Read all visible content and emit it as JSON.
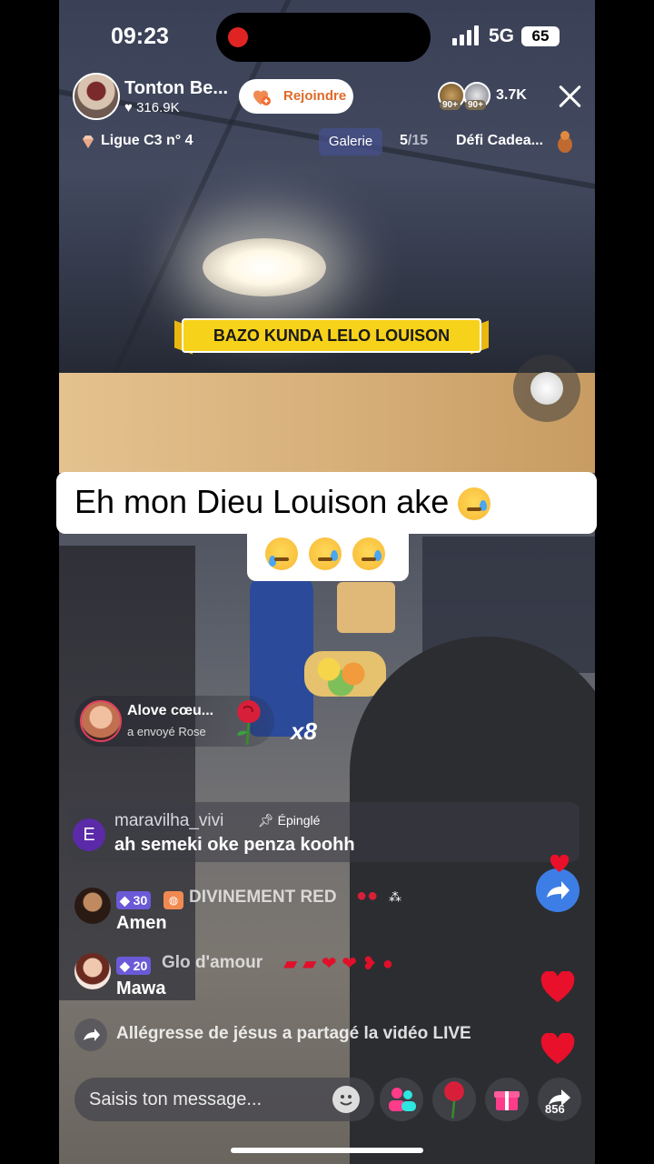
{
  "status_bar": {
    "time": "09:23",
    "network": "5G",
    "battery": "65"
  },
  "host": {
    "name": "Tonton Be...",
    "likes": "316.9K"
  },
  "join_button": {
    "label": "Rejoindre"
  },
  "viewers": {
    "badge_1": "90+",
    "badge_2": "90+",
    "count": "3.7K"
  },
  "league": {
    "label": "Ligue C3 n° 4"
  },
  "gallery": {
    "label": "Galerie",
    "current": "5",
    "total": "/15"
  },
  "challenge": {
    "label": "Défi Cadea..."
  },
  "banner": {
    "text": "BAZO KUNDA LELO LOUISON"
  },
  "caption": {
    "line1": "Eh mon Dieu Louison ake"
  },
  "gift_notification": {
    "sender": "Alove cœu...",
    "action": "a envoyé  Rose",
    "multiplier": "x8"
  },
  "pinned_comment": {
    "avatar_letter": "E",
    "user": "maravilha_vivi",
    "pin_label": "Épinglé",
    "message": "ah semeki oke penza koohh"
  },
  "comments": [
    {
      "level": "30",
      "user": "DIVINEMENT RED",
      "message": "Amen"
    },
    {
      "level": "20",
      "user": "Glo d'amour",
      "message": "Mawa"
    }
  ],
  "share_notice": {
    "text": "Allégresse de jésus a partagé la vidéo LIVE"
  },
  "bottom_bar": {
    "input_placeholder": "Saisis ton message...",
    "share_count": "856"
  },
  "icons": [
    "record-icon",
    "signal-icon",
    "battery-icon",
    "heart-icon",
    "close-icon",
    "gem-icon",
    "gift-icon",
    "rose-icon",
    "pin-icon",
    "share-icon",
    "smile-icon",
    "multi-guest-icon",
    "like-heart-icon"
  ]
}
